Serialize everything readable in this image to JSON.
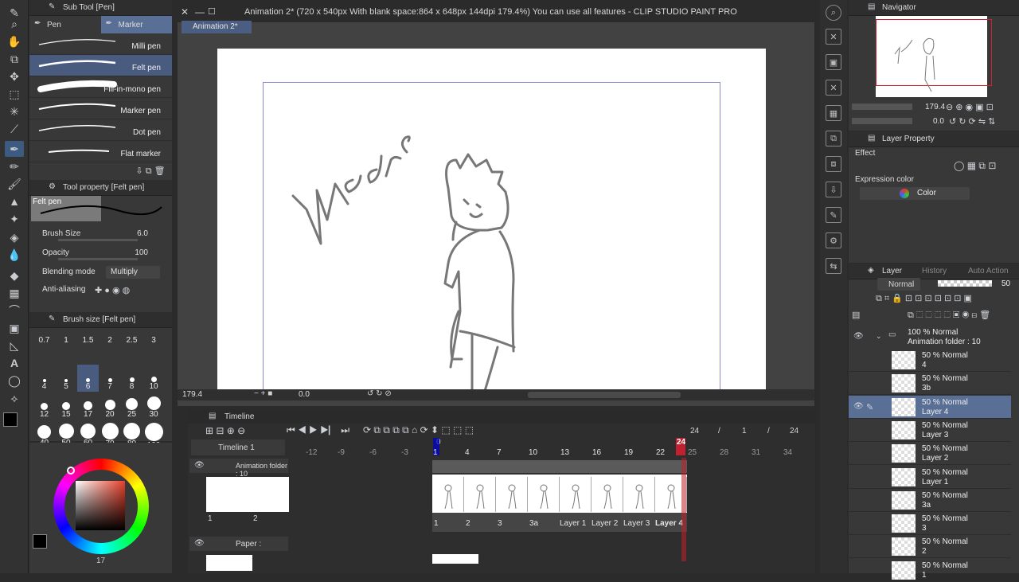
{
  "window": {
    "title": "Animation 2* (720 x 540px With blank space:864 x 648px 144dpi 179.4%)  You can use all features - CLIP STUDIO PAINT PRO",
    "doc_tab": "Animation 2*"
  },
  "subtool": {
    "header": "Sub Tool [Pen]",
    "tabs": [
      "Pen",
      "Marker"
    ],
    "brushes": [
      "Milli pen",
      "Felt pen",
      "Fill-in-mono pen",
      "Marker pen",
      "Dot pen",
      "Flat marker"
    ]
  },
  "toolprop": {
    "header": "Tool property [Felt pen]",
    "preview_label": "Felt pen",
    "brush_size_label": "Brush Size",
    "brush_size_value": "6.0",
    "opacity_label": "Opacity",
    "opacity_value": "100",
    "blending_label": "Blending mode",
    "blending_value": "Multiply",
    "antialias_label": "Anti-aliasing"
  },
  "brushsize": {
    "header": "Brush size [Felt pen]",
    "sizes": [
      "0.7",
      "1",
      "1.5",
      "2",
      "2.5",
      "3",
      "4",
      "5",
      "6",
      "7",
      "8",
      "10",
      "12",
      "15",
      "17",
      "20",
      "25",
      "30",
      "40",
      "50",
      "60",
      "70",
      "80",
      "100"
    ]
  },
  "color": {
    "main": "#000000",
    "sub": "#ffffff",
    "bottom_value": "17"
  },
  "canvas": {
    "zoom": "179.4",
    "rotation": "0.0",
    "handwriting": "Madre"
  },
  "timeline": {
    "header": "Timeline",
    "name": "Timeline 1",
    "frame_current": "24",
    "frame_sep1": "/",
    "frame_start": "1",
    "frame_sep2": "/",
    "frame_end": "24",
    "ruler": [
      "-12",
      "-9",
      "-6",
      "-3",
      "1",
      "4",
      "7",
      "10",
      "13",
      "16",
      "19",
      "22",
      "25",
      "28",
      "31",
      "34"
    ],
    "ruler_zero": "0",
    "playhead": "24",
    "track1": "Animation folder : 10",
    "track2": "Paper :",
    "thumbs_labels": [
      "1",
      "2"
    ],
    "cells": [
      "1",
      "2",
      "3",
      "3a",
      "Layer 1",
      "Layer 2",
      "Layer 3",
      "Layer 4"
    ]
  },
  "navigator": {
    "header": "Navigator",
    "zoom": "179.4",
    "rotation": "0.0"
  },
  "layerprop": {
    "header": "Layer Property",
    "effect": "Effect",
    "expression_label": "Expression color",
    "expression_value": "Color"
  },
  "layers": {
    "tabs": [
      "Layer",
      "History",
      "Auto Action"
    ],
    "blend": "Normal",
    "opacity": "50",
    "folder_mode": "100 % Normal",
    "folder_name": "Animation folder : 10",
    "items": [
      {
        "mode": "50 % Normal",
        "name": "4"
      },
      {
        "mode": "50 % Normal",
        "name": "3b"
      },
      {
        "mode": "50 % Normal",
        "name": "Layer 4"
      },
      {
        "mode": "50 % Normal",
        "name": "Layer 3"
      },
      {
        "mode": "50 % Normal",
        "name": "Layer 2"
      },
      {
        "mode": "50 % Normal",
        "name": "Layer 1"
      },
      {
        "mode": "50 % Normal",
        "name": "3a"
      },
      {
        "mode": "50 % Normal",
        "name": "3"
      },
      {
        "mode": "50 % Normal",
        "name": "2"
      },
      {
        "mode": "50 % Normal",
        "name": "1"
      }
    ]
  }
}
